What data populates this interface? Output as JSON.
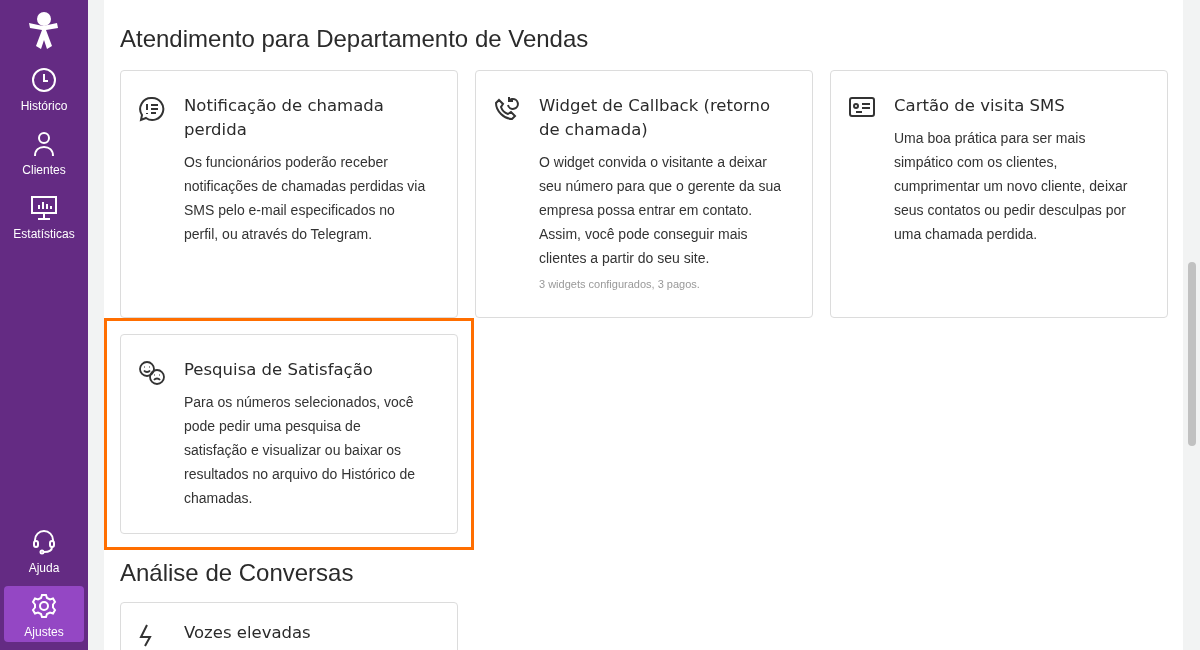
{
  "sidebar": {
    "top_items": [
      {
        "label": "Histórico",
        "selected": false
      },
      {
        "label": "Clientes",
        "selected": false
      },
      {
        "label": "Estatísticas",
        "selected": false
      }
    ],
    "bottom_items": [
      {
        "label": "Ajuda",
        "selected": false
      },
      {
        "label": "Ajustes",
        "selected": true
      }
    ]
  },
  "sections": [
    {
      "title": "Atendimento para Departamento de Vendas",
      "cards": [
        {
          "title": "Notificação de chamada perdida",
          "text": "Os funcionários poderão receber notificações de chamadas perdidas via SMS pelo e-mail especificados no perfil, ou através do Telegram.",
          "highlighted": false
        },
        {
          "title": "Widget de Callback (retorno de chamada)",
          "text": "O widget convida o visitante a deixar seu número para que o gerente da sua empresa possa entrar em contato. Assim, você pode conseguir mais clientes a partir do seu site.",
          "note": "3 widgets configurados, 3 pagos.",
          "highlighted": false
        },
        {
          "title": "Cartão de visita SMS",
          "text": "Uma boa prática para ser mais simpático com os clientes, cumprimentar um novo cliente, deixar seus contatos ou pedir desculpas por uma chamada perdida.",
          "highlighted": false
        },
        {
          "title": "Pesquisa de Satisfação",
          "text": "Para os números selecionados, você pode pedir uma pesquisa de satisfação e visualizar ou baixar os resultados no arquivo do Histórico de chamadas.",
          "highlighted": true
        }
      ]
    },
    {
      "title": "Análise de Conversas",
      "cards": [
        {
          "title": "Vozes elevadas",
          "highlighted": false
        }
      ]
    }
  ]
}
